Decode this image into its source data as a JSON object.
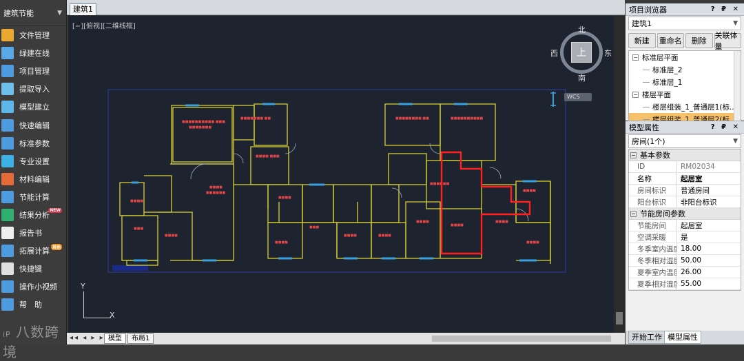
{
  "sidebar": {
    "title": "建筑节能",
    "items": [
      {
        "label": "文件管理",
        "icon": "folder-icon",
        "color": "#e9a830"
      },
      {
        "label": "绿建在线",
        "icon": "cloud-icon",
        "color": "#5aa9e6"
      },
      {
        "label": "项目管理",
        "icon": "project-icon",
        "color": "#4f9be0"
      },
      {
        "label": "提取导入",
        "icon": "import-icon",
        "color": "#6ec0ea"
      },
      {
        "label": "模型建立",
        "icon": "model-icon",
        "color": "#5fb6e8"
      },
      {
        "label": "快速编辑",
        "icon": "quick-edit-icon",
        "color": "#4f9be0"
      },
      {
        "label": "标准参数",
        "icon": "standard-params-icon",
        "color": "#4f9be0"
      },
      {
        "label": "专业设置",
        "icon": "settings-globe-icon",
        "color": "#3db0e6"
      },
      {
        "label": "材料编辑",
        "icon": "material-icon",
        "color": "#e46a3a"
      },
      {
        "label": "节能计算",
        "icon": "calc-icon",
        "color": "#4f9be0"
      },
      {
        "label": "结果分析",
        "icon": "analysis-icon",
        "color": "#2fb070",
        "badge": "NEW"
      },
      {
        "label": "报告书",
        "icon": "report-icon",
        "color": "#eeeeee"
      },
      {
        "label": "拓展计算",
        "icon": "extend-calc-icon",
        "color": "#4f9be0",
        "badge": "其他"
      },
      {
        "label": "快捷键",
        "icon": "shortcut-gear-icon",
        "color": "#e0e0e0"
      },
      {
        "label": "操作小视频",
        "icon": "video-icon",
        "color": "#4f9be0"
      },
      {
        "label": "帮　助",
        "icon": "help-icon",
        "color": "#4f9be0"
      }
    ]
  },
  "watermark": {
    "text": "八数跨境",
    "prefix": "iP"
  },
  "document": {
    "tab": "建筑1",
    "view_label": "[−][俯视][二维线框]"
  },
  "viewcube": {
    "north": "北",
    "south": "南",
    "east": "东",
    "west": "西",
    "top": "上",
    "wcs": "WCS"
  },
  "ucs": {
    "x": "X",
    "y": "Y"
  },
  "layout_tabs": {
    "nav": "◂◂ ◂ ▸ ▸▸",
    "model": "模型",
    "layout1": "布局1"
  },
  "project_browser": {
    "title": "项目浏览器",
    "controls": "? ₽ ✕",
    "selector": "建筑1",
    "buttons": [
      "新建",
      "重命名",
      "删除",
      "关联体量"
    ],
    "tree": [
      {
        "label": "标准层平面",
        "level": 0,
        "expand": "⊟"
      },
      {
        "label": "标准层_2",
        "level": 1
      },
      {
        "label": "标准层_1",
        "level": 1
      },
      {
        "label": "楼层平面",
        "level": 0,
        "expand": "⊟"
      },
      {
        "label": "楼层组装_1_普通层1(标...",
        "level": 1
      },
      {
        "label": "楼层组装_1_普通层2(标",
        "level": 1,
        "selected": true
      }
    ]
  },
  "model_properties": {
    "title": "模型属性",
    "controls": "? ₽ ✕",
    "selector": "房间(1个)",
    "categories": [
      {
        "name": "基本参数",
        "rows": [
          {
            "key": "ID",
            "value": "RM02034",
            "readonly": true
          },
          {
            "key": "名称",
            "value": "起居室",
            "bold": true
          },
          {
            "key": "房间标识",
            "value": "普通房间"
          },
          {
            "key": "阳台标识",
            "value": "非阳台标识"
          }
        ]
      },
      {
        "name": "节能房间参数",
        "rows": [
          {
            "key": "节能房间",
            "value": "起居室"
          },
          {
            "key": "空调采暖",
            "value": "是"
          },
          {
            "key": "冬季室内温度(℃",
            "value": "18.00"
          },
          {
            "key": "冬季相对湿度(%",
            "value": "50.00"
          },
          {
            "key": "夏季室内温度(℃",
            "value": "26.00"
          },
          {
            "key": "夏季相对湿度(%",
            "value": "55.00"
          }
        ]
      }
    ]
  },
  "bottom_tabs": [
    "开始工作",
    "模型属性"
  ],
  "colors": {
    "viewport_bg": "#1e2330",
    "wall": "#d9d23a",
    "selection": "#ff2020",
    "room_text": "#e04545",
    "window": "#3aa0e0"
  }
}
